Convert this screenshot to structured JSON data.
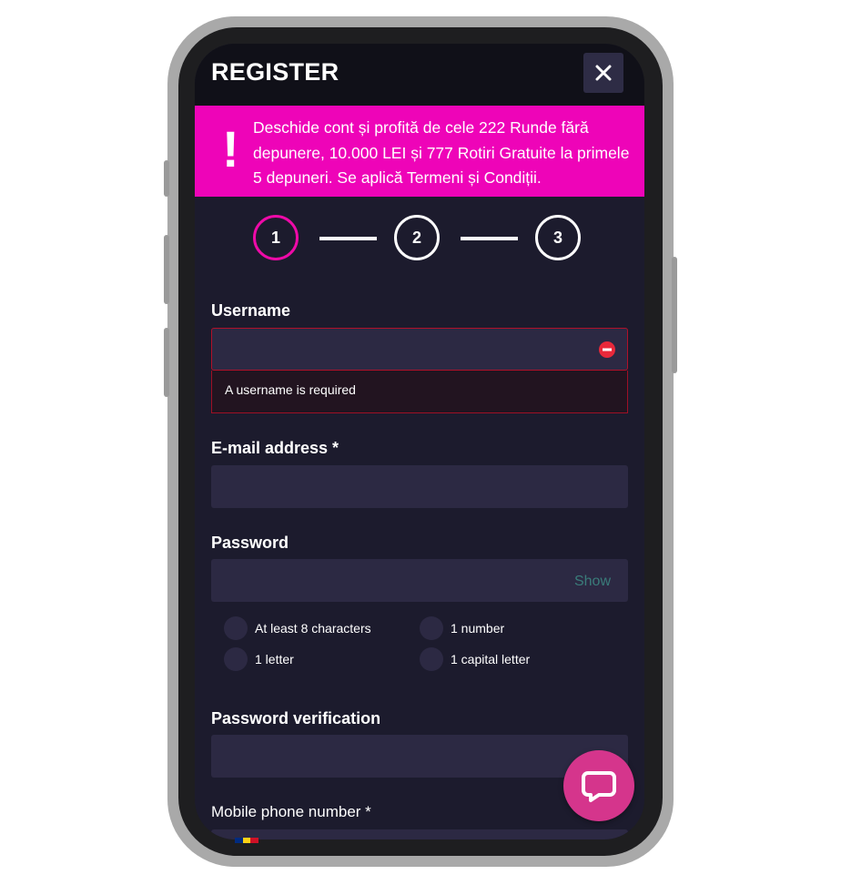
{
  "header": {
    "title": "REGISTER"
  },
  "banner": {
    "icon": "!",
    "text": "Deschide cont și profită de cele 222 Runde fără depunere, 10.000 LEI și 777 Rotiri Gratuite la primele 5 depuneri. Se aplică Termeni și Condiții."
  },
  "stepper": {
    "steps": [
      "1",
      "2",
      "3"
    ],
    "active_step": 1
  },
  "username": {
    "label": "Username",
    "value": "",
    "error": "A username is required"
  },
  "email": {
    "label": "E-mail address *",
    "value": ""
  },
  "password": {
    "label": "Password",
    "value": "",
    "show_label": "Show",
    "requirements": [
      "At least 8 characters",
      "1 number",
      "1 letter",
      "1 capital letter"
    ]
  },
  "password_verification": {
    "label": "Password verification",
    "value": ""
  },
  "mobile": {
    "label": "Mobile phone number *"
  },
  "colors": {
    "accent": "#ee04b8",
    "background": "#1c1b2d",
    "field": "#2c2943",
    "error": "#b0112a",
    "chat": "#d5358c"
  },
  "icons": {
    "close": "close-icon",
    "error": "minus-circle-icon",
    "chat": "chat-bubble-icon",
    "flag": "romania-flag-icon"
  }
}
